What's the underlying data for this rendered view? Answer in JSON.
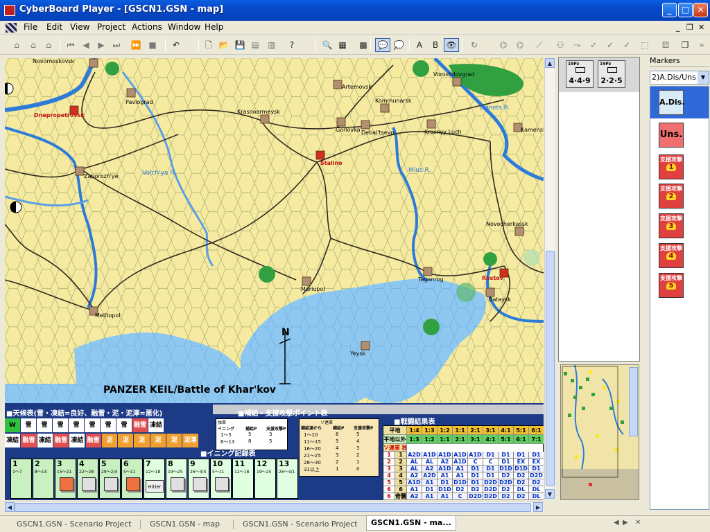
{
  "window": {
    "title": "CyberBoard Player - [GSCN1.GSN - map]",
    "minimize": "_",
    "maximize": "□",
    "close": "✕"
  },
  "menu": {
    "items": [
      "File",
      "Edit",
      "View",
      "Project",
      "Actions",
      "Window",
      "Help"
    ],
    "mdi_minimize": "_",
    "mdi_restore": "❐",
    "mdi_close": "✕"
  },
  "map": {
    "title": "PANZER KEIL/Battle of Khar'kov",
    "compass": "N",
    "cities": [
      {
        "name": "Novomoskovsk"
      },
      {
        "name": "Pavlograd"
      },
      {
        "name": "Dnepropetrovsk"
      },
      {
        "name": "Artemovsk"
      },
      {
        "name": "Voroshilovgrad"
      },
      {
        "name": "Krasnoarmeysk"
      },
      {
        "name": "Kommunarsk"
      },
      {
        "name": "Gorlovka"
      },
      {
        "name": "Debal'tsevo"
      },
      {
        "name": "Krasnyy Luch"
      },
      {
        "name": "Kamensk"
      },
      {
        "name": "Stalino"
      },
      {
        "name": "Zaporozh'ye"
      },
      {
        "name": "Novocherkassk"
      },
      {
        "name": "Rostov"
      },
      {
        "name": "Mariupol"
      },
      {
        "name": "Taganrog"
      },
      {
        "name": "Bataysk"
      },
      {
        "name": "Melitopol"
      },
      {
        "name": "Yeysk"
      }
    ],
    "rivers": [
      {
        "name": "Donets R."
      },
      {
        "name": "Volch'ya R."
      },
      {
        "name": "Mius R."
      }
    ],
    "weather_table": {
      "title": "■天候表(雪・凍結=良好、融雪・泥・泥濘=悪化)",
      "row1": [
        "W",
        "雪",
        "雪",
        "雪",
        "雪",
        "雪",
        "雪",
        "雪",
        "融雪",
        "凍結"
      ],
      "row2": [
        "凍結",
        "融雪",
        "凍結",
        "融雪",
        "凍結",
        "融雪",
        "泥",
        "泥",
        "泥",
        "泥",
        "泥",
        "泥濘"
      ]
    },
    "supply_table": {
      "title": "■補給・支援攻撃ポイント表",
      "german_header": "独軍",
      "soviet_header": "ソ連軍",
      "cols": [
        "イニング",
        "補給P",
        "支援攻撃P"
      ],
      "german_rows": [
        [
          "1〜5",
          "5",
          "3"
        ],
        [
          "6〜13",
          "8",
          "5"
        ]
      ],
      "soviet_cols": [
        "補給源から",
        "補給P",
        "支援攻撃P"
      ],
      "soviet_rows": [
        [
          "1〜10",
          "6",
          "5"
        ],
        [
          "11〜15",
          "5",
          "4"
        ],
        [
          "16〜20",
          "4",
          "3"
        ],
        [
          "21〜25",
          "3",
          "2"
        ],
        [
          "26〜30",
          "2",
          "1"
        ],
        [
          "31以上",
          "1",
          "0"
        ]
      ]
    },
    "inning_track": {
      "title": "■イニング記録表",
      "cells": [
        {
          "num": "1",
          "range": "1〜7"
        },
        {
          "num": "2",
          "range": "8〜14"
        },
        {
          "num": "3",
          "range": "15〜21"
        },
        {
          "num": "4",
          "range": "22〜28"
        },
        {
          "num": "5",
          "range": "29〜2/4"
        },
        {
          "num": "6",
          "range": "5〜11"
        },
        {
          "num": "7",
          "range": "12〜18"
        },
        {
          "num": "8",
          "range": "19〜25"
        },
        {
          "num": "9",
          "range": "26〜3/4"
        },
        {
          "num": "10",
          "range": "5〜11"
        },
        {
          "num": "11",
          "range": "12〜18"
        },
        {
          "num": "12",
          "range": "19〜25"
        },
        {
          "num": "13",
          "range": "26〜4/1"
        }
      ],
      "hitler": "Hitler"
    },
    "combat_table": {
      "title": "■戦闘結果表",
      "terrain_rows": [
        {
          "label": "平地",
          "ratios": [
            "1:4",
            "1:3",
            "1:2",
            "1:1",
            "2:1",
            "3:1",
            "4:1",
            "5:1",
            "6:1"
          ]
        },
        {
          "label": "平地以外",
          "ratios": [
            "1:3",
            "1:2",
            "1:1",
            "2:1",
            "3:1",
            "4:1",
            "5:1",
            "6:1",
            "7:1"
          ]
        }
      ],
      "soviet_label": "ソ連軍",
      "german_label": "独軍",
      "rows": [
        {
          "s": "1",
          "g": "1",
          "r": [
            "A2D",
            "A1D",
            "A1D",
            "A1D",
            "A1D",
            "D1",
            "D1",
            "D1",
            "D1"
          ]
        },
        {
          "s": "2",
          "g": "2",
          "r": [
            "AL",
            "AL",
            "A2",
            "A1D",
            "C",
            "C",
            "D1",
            "EX",
            "EX"
          ]
        },
        {
          "s": "3",
          "g": "3",
          "r": [
            "AL",
            "A2",
            "A1D",
            "A1",
            "D1",
            "D1",
            "D1D",
            "D1D",
            "D1"
          ]
        },
        {
          "s": "4",
          "g": "4",
          "r": [
            "A2",
            "A2D",
            "A1",
            "A1",
            "D1",
            "D1",
            "D2",
            "D2",
            "D2D"
          ]
        },
        {
          "s": "5",
          "g": "5",
          "r": [
            "A1D",
            "A1",
            "D1",
            "D1D",
            "D1",
            "D2D",
            "D2D",
            "D2",
            "D2"
          ]
        },
        {
          "s": "6",
          "g": "6",
          "r": [
            "A1",
            "D1",
            "D1D",
            "D2",
            "D2",
            "D2D",
            "D2",
            "DL",
            "DL"
          ]
        },
        {
          "s": "6",
          "g": "奇襲",
          "r": [
            "A2",
            "A1",
            "A1",
            "C",
            "D2D",
            "D2D",
            "D2",
            "D2",
            "DL"
          ]
        }
      ]
    }
  },
  "tray": {
    "counters": [
      {
        "size": "19Pz",
        "strength": "4·4·9"
      },
      {
        "size": "19Pz",
        "strength": "2·2·5"
      }
    ]
  },
  "markers": {
    "header": "Markers",
    "selected_tray": "2)A.Dis/Uns",
    "items": [
      {
        "label": "A.Dis."
      },
      {
        "label": "Uns."
      },
      {
        "label": "支援攻撃",
        "num": "1"
      },
      {
        "label": "支援攻撃",
        "num": "2"
      },
      {
        "label": "支援攻撃",
        "num": "3"
      },
      {
        "label": "支援攻撃",
        "num": "4"
      },
      {
        "label": "支援攻撃",
        "num": "5"
      }
    ]
  },
  "tabs": [
    {
      "label": "GSCN1.GSN - Scenario Project"
    },
    {
      "label": "GSCN1.GSN - map"
    },
    {
      "label": "GSCN1.GSN - Scenario Project"
    },
    {
      "label": "GSCN1.GSN - ma..."
    }
  ],
  "colors": {
    "terrain": "#f6eaa0",
    "water": "#8ec8f0",
    "river": "#2d7bd8",
    "city_red": "#d03020",
    "forest": "#30a040",
    "xp_blue": "#0342b8"
  }
}
